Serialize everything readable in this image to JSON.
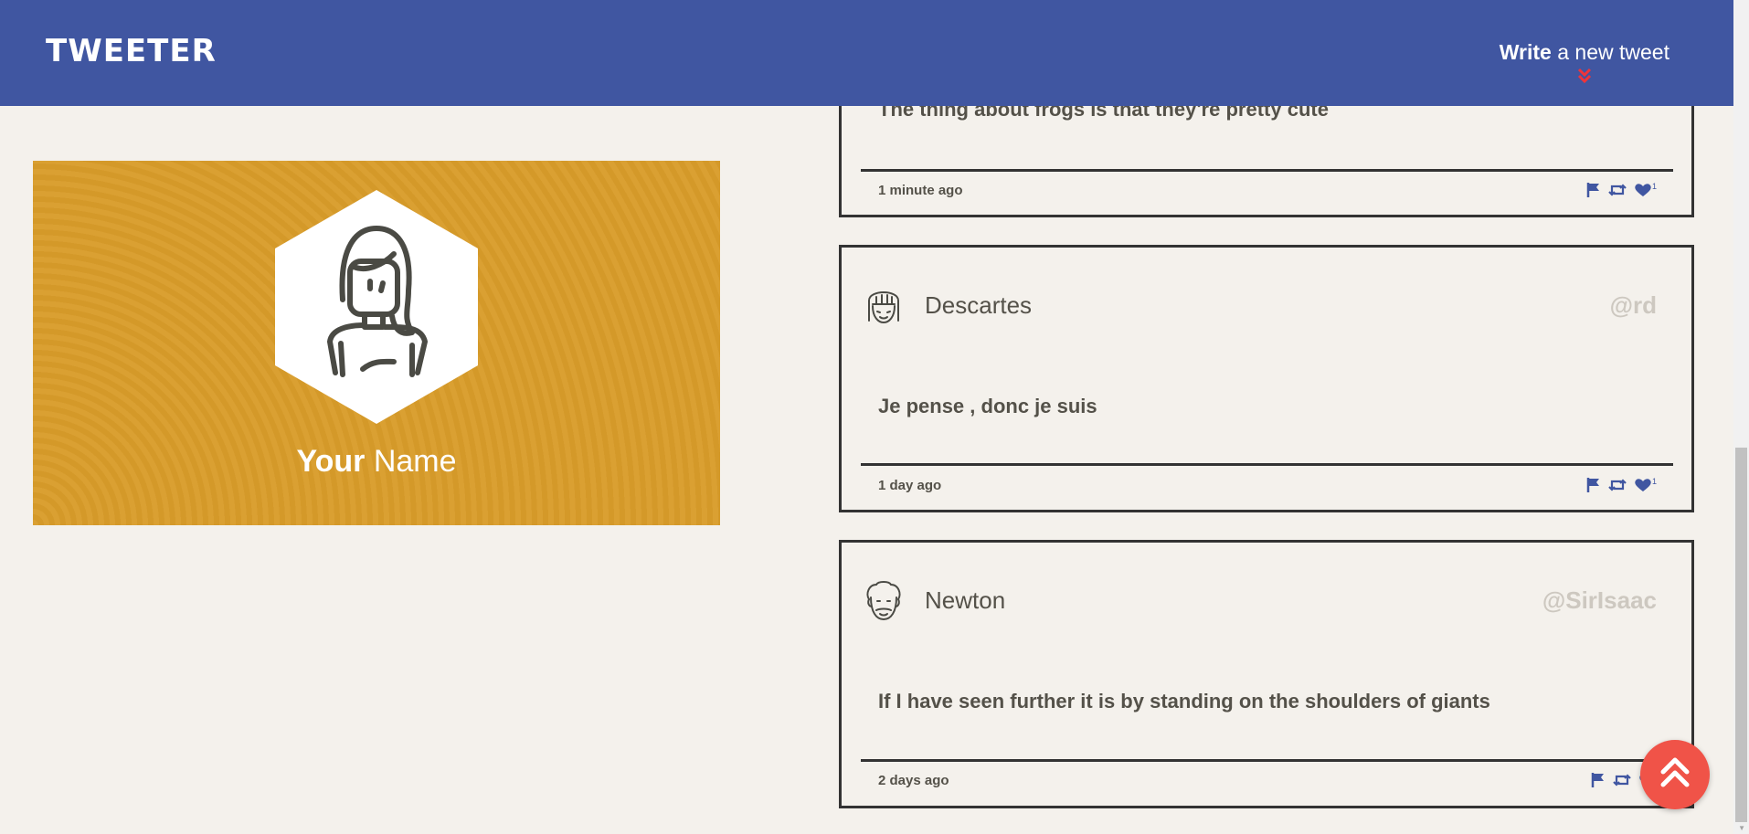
{
  "nav": {
    "logo": "TWEETER",
    "compose_bold": "Write",
    "compose_rest": "a new tweet"
  },
  "profile": {
    "first": "Your",
    "last": "Name",
    "background_color": "#d89c2a"
  },
  "tweets": [
    {
      "text": "The thing about frogs is that they're pretty cute",
      "time": "1 minute ago",
      "likes": "1"
    },
    {
      "name": "Descartes",
      "handle": "@rd",
      "text": "Je pense , donc je suis",
      "time": "1 day ago",
      "likes": "1"
    },
    {
      "name": "Newton",
      "handle": "@SirIsaac",
      "text": "If I have seen further it is by standing on the shoulders of giants",
      "time": "2 days ago"
    }
  ],
  "icons": [
    "flag-icon",
    "retweet-icon",
    "heart-icon",
    "double-chevron-down-icon",
    "double-chevron-up-icon"
  ],
  "colors": {
    "nav": "#4056a1",
    "accent": "#f05348",
    "icon": "#4056a1"
  }
}
